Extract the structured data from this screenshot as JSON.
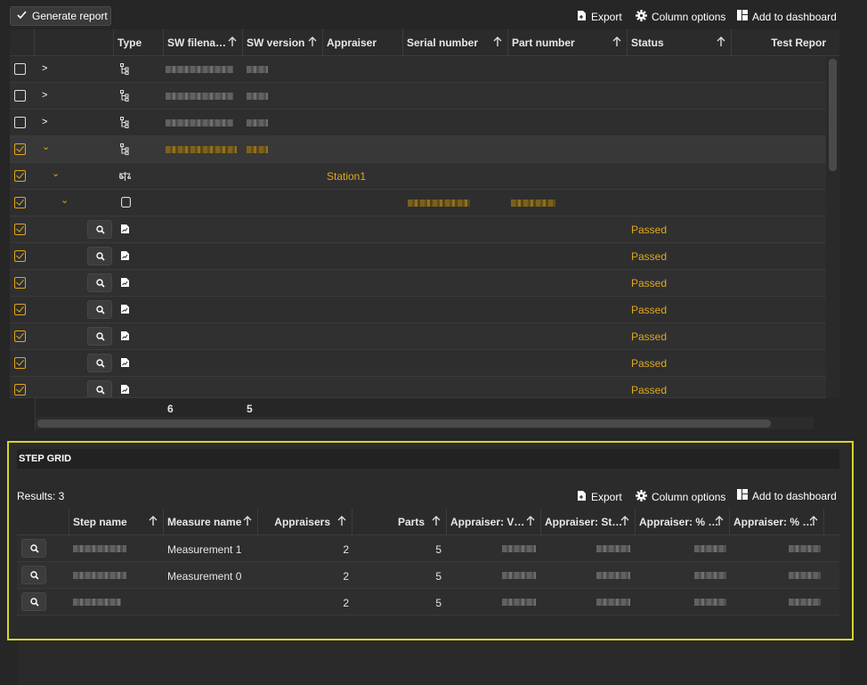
{
  "toolbar": {
    "generate_label": "Generate report",
    "export_label": "Export",
    "columns_label": "Column options",
    "dashboard_label": "Add to dashboard"
  },
  "main_grid": {
    "columns": [
      "Type",
      "SW filena…",
      "SW version",
      "Appraiser",
      "Serial number",
      "Part number",
      "Status",
      "Test Repor"
    ],
    "appraiser_value": "Station1",
    "status_value": "Passed",
    "footer_counts": [
      "6",
      "5"
    ]
  },
  "step_grid": {
    "title": "STEP GRID",
    "results_label": "Results: 3",
    "export_label": "Export",
    "columns_label": "Column options",
    "dashboard_label": "Add to dashboard",
    "columns": [
      "Step name",
      "Measure name",
      "Appraisers",
      "Parts",
      "Appraiser: V…",
      "Appraiser: St…",
      "Appraiser: % …",
      "Appraiser: % …"
    ],
    "rows": [
      {
        "measure": "Measurement 1",
        "appraisers": "2",
        "parts": "5"
      },
      {
        "measure": "Measurement 0",
        "appraisers": "2",
        "parts": "5"
      },
      {
        "measure": "",
        "appraisers": "2",
        "parts": "5"
      }
    ]
  },
  "colors": {
    "accent": "#e0a81c",
    "highlight_border": "#d4d42a"
  }
}
